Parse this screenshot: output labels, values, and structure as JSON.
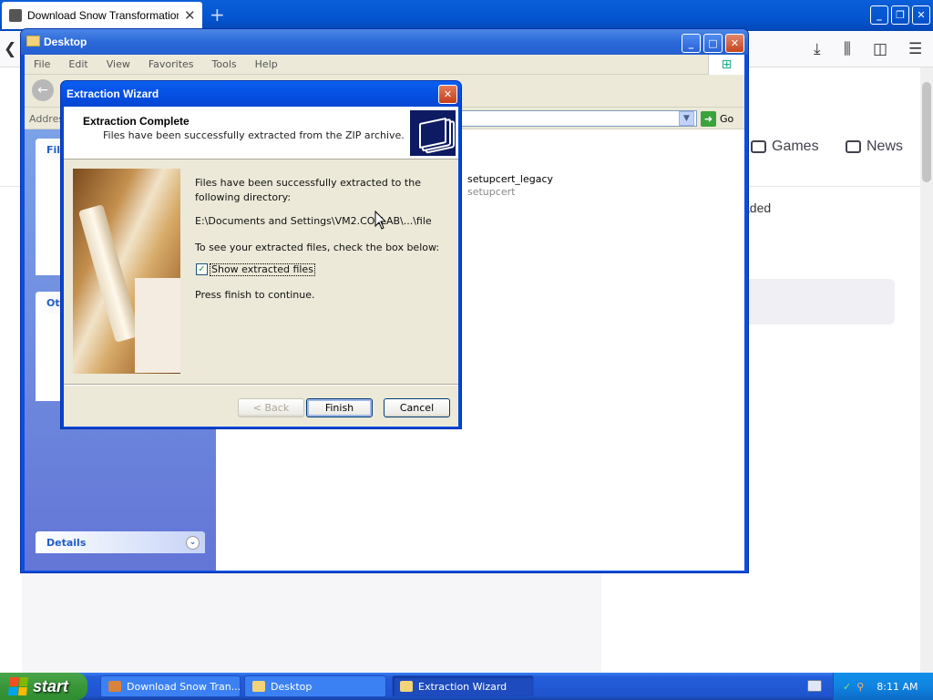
{
  "browser": {
    "tab_title": "Download Snow Transformation Pa",
    "new_tab": "+",
    "window_buttons": [
      "_",
      "❐",
      "✕"
    ],
    "nav_items": [
      "Games",
      "News"
    ],
    "downloaded_text": "aded"
  },
  "explorer": {
    "title": "Desktop",
    "menu": [
      "File",
      "Edit",
      "View",
      "Favorites",
      "Tools",
      "Help"
    ],
    "address_label": "Addres",
    "go_label": "Go",
    "side_panels": {
      "file_tasks": "File",
      "other_places": "Oth",
      "details": "Details"
    },
    "file": {
      "name": "setupcert_legacy",
      "subtitle": "setupcert"
    }
  },
  "wizard": {
    "title": "Extraction Wizard",
    "header_title": "Extraction Complete",
    "header_subtitle": "Files have been successfully extracted from the ZIP archive.",
    "message": "Files have been successfully extracted to the following directory:",
    "path": "E:\\Documents and Settings\\VM2.COLLAB\\...\\file",
    "check_prompt": "To see your extracted files, check the box below:",
    "checkbox_label": "Show extracted files",
    "checkbox_checked": true,
    "continue_text": "Press finish to continue.",
    "buttons": {
      "back": "< Back",
      "finish": "Finish",
      "cancel": "Cancel"
    }
  },
  "taskbar": {
    "start_label": "start",
    "tasks": [
      {
        "label": "Download Snow Tran...",
        "active": false
      },
      {
        "label": "Desktop",
        "active": false
      },
      {
        "label": "Extraction Wizard",
        "active": true
      }
    ],
    "clock": "8:11 AM"
  },
  "colors": {
    "xp_blue": "#0a4ee0",
    "taskbar_blue": "#245edb",
    "start_green": "#399639",
    "dialog_face": "#ece9d8"
  }
}
